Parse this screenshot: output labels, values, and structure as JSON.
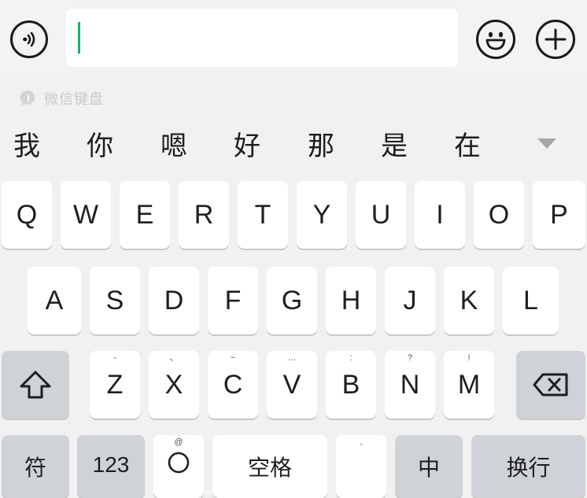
{
  "input": {
    "value": "",
    "placeholder": ""
  },
  "brand": {
    "text": "微信键盘"
  },
  "candidates": [
    "我",
    "你",
    "嗯",
    "好",
    "那",
    "是",
    "在"
  ],
  "keyboard": {
    "row1": [
      "Q",
      "W",
      "E",
      "R",
      "T",
      "Y",
      "U",
      "I",
      "O",
      "P"
    ],
    "row2": [
      "A",
      "S",
      "D",
      "F",
      "G",
      "H",
      "J",
      "K",
      "L"
    ],
    "row3": [
      {
        "label": "Z",
        "hint": "-"
      },
      {
        "label": "X",
        "hint": "、"
      },
      {
        "label": "C",
        "hint": "~"
      },
      {
        "label": "V",
        "hint": "…"
      },
      {
        "label": "B",
        "hint": ":"
      },
      {
        "label": "N",
        "hint": "?"
      },
      {
        "label": "M",
        "hint": "!"
      }
    ],
    "bottom_row": {
      "symbols": "符",
      "numbers": "123",
      "emoji_hint": "@",
      "space": "空格",
      "comma_hint": ",",
      "lang": "中",
      "enter": "换行"
    }
  },
  "colors": {
    "caret": "#18b06a",
    "background": "#f1f1f1",
    "key": "#ffffff",
    "function_key": "#cfd2d7"
  }
}
